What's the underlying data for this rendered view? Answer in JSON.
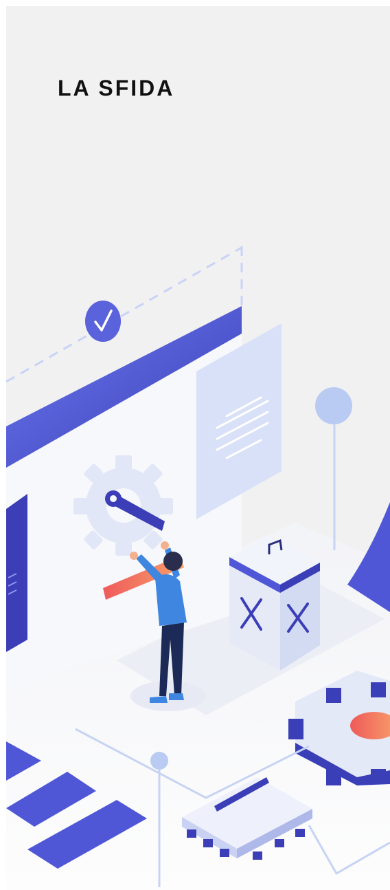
{
  "section": {
    "title": "LA SFIDA"
  },
  "illustration": {
    "accent_color": "#4f57d6",
    "accent_dark": "#2e2f9a",
    "light_blue": "#c9d6f6",
    "warm_start": "#f7a06a",
    "warm_end": "#ef5a5a",
    "icons": [
      "checkmark-icon",
      "gear-wrench-icon",
      "document-icon",
      "trash-bin-icon",
      "gear-icon",
      "microchip-icon"
    ]
  }
}
